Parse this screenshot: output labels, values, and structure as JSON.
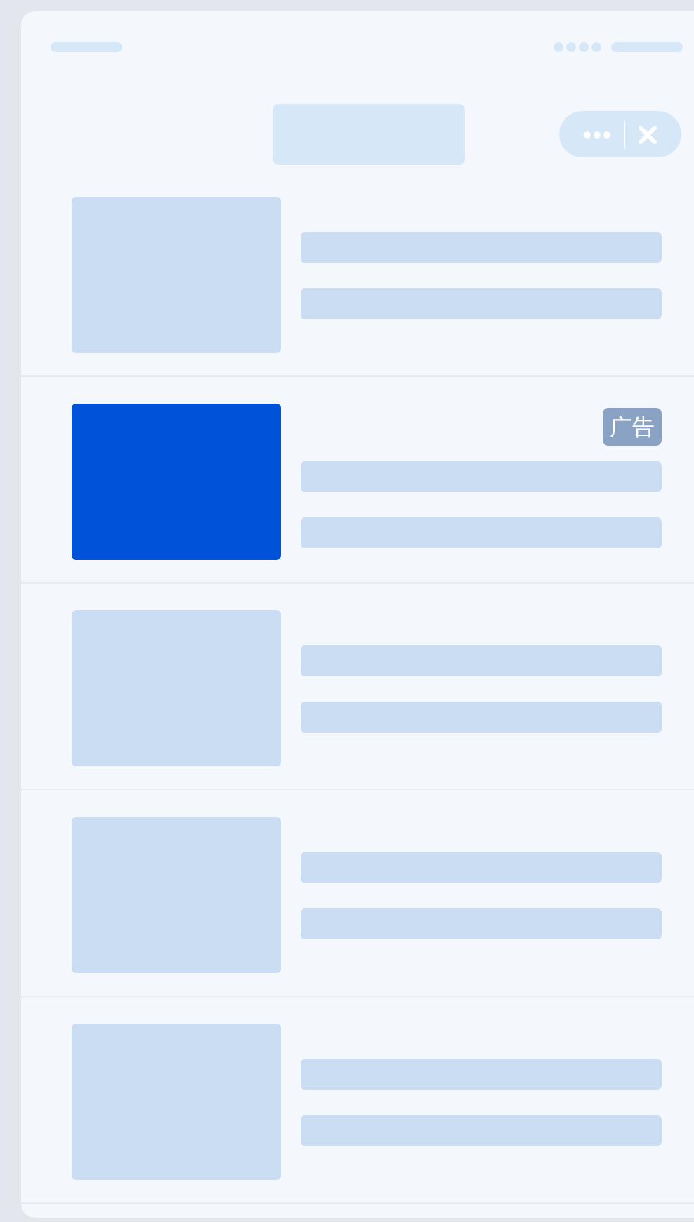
{
  "items": [
    {
      "kind": "placeholder"
    },
    {
      "kind": "ad",
      "badge": "广告"
    },
    {
      "kind": "placeholder"
    },
    {
      "kind": "placeholder"
    },
    {
      "kind": "placeholder"
    }
  ]
}
